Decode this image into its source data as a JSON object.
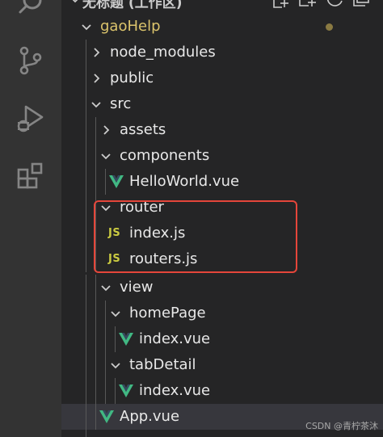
{
  "colors": {
    "activity_bar": "#333333",
    "sidebar": "#252526",
    "text": "#e8e8e8",
    "modified_folder": "#dcc46c",
    "vue_icon": "#41b883",
    "js_badge": "#cbcb41",
    "selected_row": "#37373d",
    "highlight_box": "#e5463a"
  },
  "activity_bar": {
    "items": [
      {
        "icon": "search-icon"
      },
      {
        "icon": "source-control-icon"
      },
      {
        "icon": "run-debug-icon"
      },
      {
        "icon": "extensions-icon"
      }
    ]
  },
  "workspace": {
    "title": "无标题 (工作区)",
    "actions": [
      "new-file-icon",
      "new-folder-icon",
      "refresh-icon",
      "collapse-all-icon"
    ]
  },
  "tree": {
    "root": {
      "label": "gaoHelp",
      "modified": true
    },
    "node_modules": {
      "label": "node_modules"
    },
    "public": {
      "label": "public"
    },
    "src": {
      "label": "src"
    },
    "assets": {
      "label": "assets"
    },
    "components": {
      "label": "components"
    },
    "helloworld": {
      "label": "HelloWorld.vue"
    },
    "router": {
      "label": "router"
    },
    "router_index": {
      "label": "index.js",
      "badge": "JS"
    },
    "routers": {
      "label": "routers.js",
      "badge": "JS"
    },
    "view": {
      "label": "view"
    },
    "homepage": {
      "label": "homePage"
    },
    "homepage_index": {
      "label": "index.vue"
    },
    "tabdetail": {
      "label": "tabDetail"
    },
    "tabdetail_index": {
      "label": "index.vue"
    },
    "app": {
      "label": "App.vue",
      "selected": true
    }
  },
  "watermark": "CSDN @青柠茶沐"
}
